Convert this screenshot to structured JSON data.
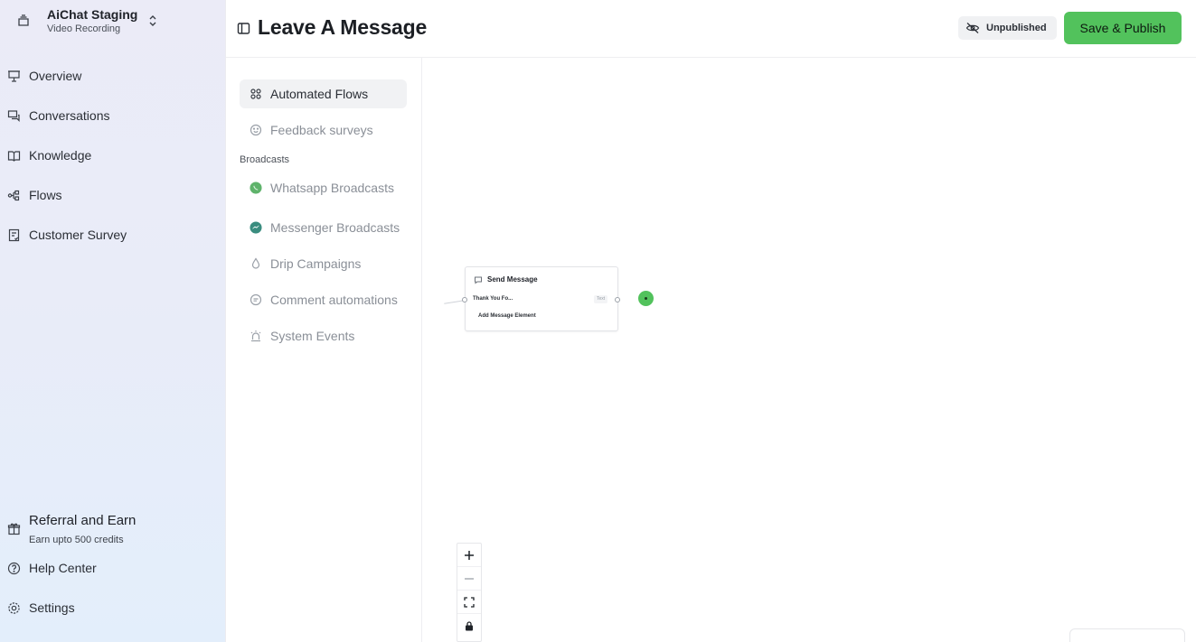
{
  "workspace": {
    "name": "AiChat Staging",
    "subtitle": "Video Recording"
  },
  "sidebar": {
    "items": [
      {
        "label": "Overview",
        "icon": "presentation-icon"
      },
      {
        "label": "Conversations",
        "icon": "chat-bubbles-icon"
      },
      {
        "label": "Knowledge",
        "icon": "book-open-icon"
      },
      {
        "label": "Flows",
        "icon": "flow-nodes-icon"
      },
      {
        "label": "Customer Survey",
        "icon": "survey-icon"
      }
    ],
    "referral": {
      "title": "Referral and Earn",
      "subtitle": "Earn upto 500 credits",
      "icon": "gift-icon"
    },
    "help": {
      "label": "Help Center",
      "icon": "help-circle-icon"
    },
    "settings": {
      "label": "Settings",
      "icon": "gear-icon"
    }
  },
  "header": {
    "title": "Leave A Message",
    "status_label": "Unpublished",
    "publish_label": "Save & Publish"
  },
  "subnav": {
    "items": [
      {
        "label": "Automated Flows",
        "icon": "grid-icon",
        "active": true
      },
      {
        "label": "Feedback surveys",
        "icon": "smiley-icon",
        "active": false
      }
    ],
    "heading": "Broadcasts",
    "broadcasts": [
      {
        "label": "Whatsapp Broadcasts",
        "icon": "whatsapp-icon"
      },
      {
        "label": "Messenger Broadcasts",
        "icon": "messenger-icon"
      },
      {
        "label": "Drip Campaigns",
        "icon": "drop-icon"
      },
      {
        "label": "Comment automations",
        "icon": "comment-icon"
      },
      {
        "label": "System Events",
        "icon": "siren-icon"
      }
    ]
  },
  "canvas": {
    "node": {
      "title": "Send Message",
      "message": "Thank You Fo...",
      "tag": "Text",
      "add_label": "Add Message Element"
    }
  },
  "colors": {
    "accent": "#52c25c",
    "sidebar_top": "#ebebf7",
    "sidebar_bottom": "#e3eefb"
  }
}
